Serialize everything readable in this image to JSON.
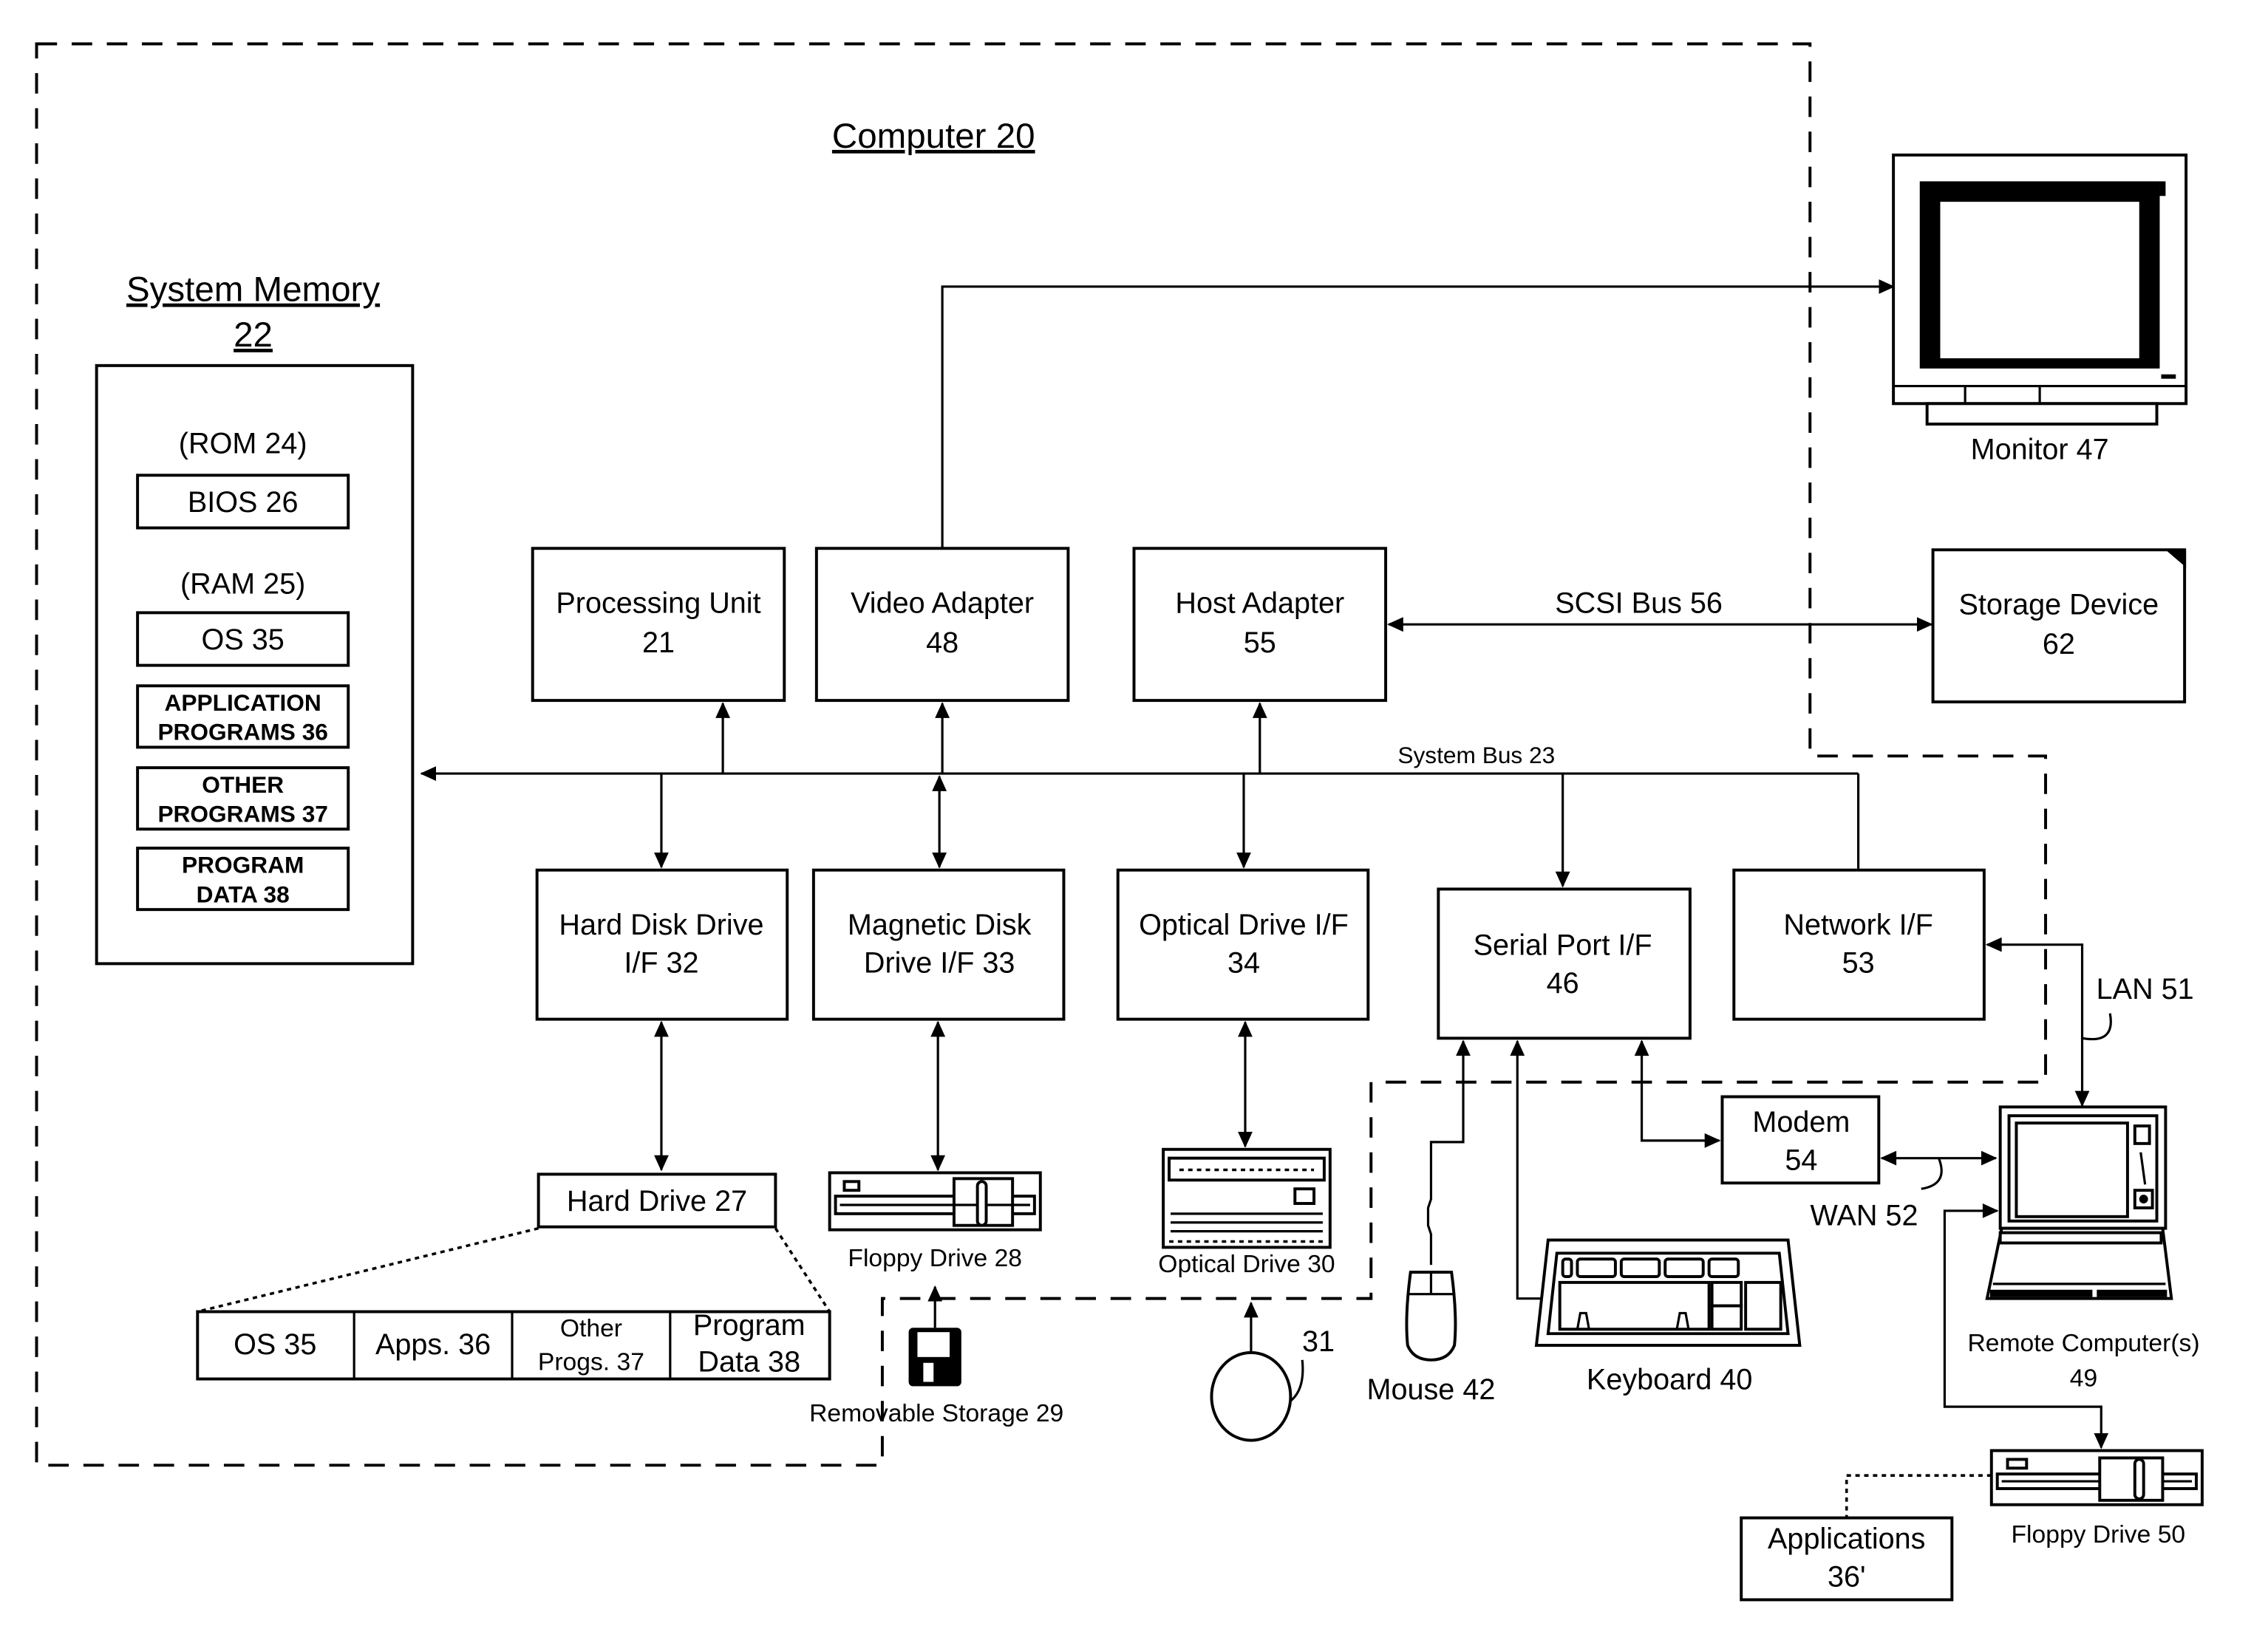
{
  "figure": {
    "computer_label": "Computer 20",
    "system_memory": {
      "title_line1": "System Memory",
      "title_line2": "22",
      "rom_label": "(ROM 24)",
      "bios_label": "BIOS 26",
      "ram_label": "(RAM 25)",
      "ram_items": [
        {
          "line1": "OS 35",
          "line2": ""
        },
        {
          "line1": "APPLICATION",
          "line2": "PROGRAMS 36"
        },
        {
          "line1": "OTHER",
          "line2": "PROGRAMS 37"
        },
        {
          "line1": "PROGRAM",
          "line2": "DATA 38"
        }
      ]
    },
    "upper_blocks": [
      {
        "line1": "Processing Unit",
        "line2": "21"
      },
      {
        "line1": "Video Adapter",
        "line2": "48"
      },
      {
        "line1": "Host Adapter",
        "line2": "55"
      }
    ],
    "system_bus_label": "System Bus 23",
    "scsi_bus_label": "SCSI Bus 56",
    "lower_blocks": [
      {
        "line1": "Hard Disk Drive",
        "line2": "I/F 32"
      },
      {
        "line1": "Magnetic Disk",
        "line2": "Drive I/F 33"
      },
      {
        "line1": "Optical Drive I/F",
        "line2": "34"
      },
      {
        "line1": "Serial Port I/F",
        "line2": "46"
      },
      {
        "line1": "Network I/F",
        "line2": "53"
      }
    ],
    "monitor_label": "Monitor 47",
    "storage_device": {
      "line1": "Storage Device",
      "line2": "62"
    },
    "hard_drive_label": "Hard Drive 27",
    "hard_drive_contents": [
      {
        "line1": "OS 35",
        "line2": ""
      },
      {
        "line1": "Apps. 36",
        "line2": ""
      },
      {
        "line1": "Other",
        "line2": "Progs. 37"
      },
      {
        "line1": "Program",
        "line2": "Data 38"
      }
    ],
    "floppy_drive_label": "Floppy Drive 28",
    "optical_drive_label": "Optical Drive 30",
    "removable_storage_label": "Removable Storage 29",
    "optical_disc_ref": "31",
    "mouse_label": "Mouse 42",
    "keyboard_label": "Keyboard 40",
    "modem": {
      "line1": "Modem",
      "line2": "54"
    },
    "lan_label": "LAN 51",
    "wan_label": "WAN 52",
    "remote_computer": {
      "line1": "Remote Computer(s)",
      "line2": "49"
    },
    "remote_floppy_label": "Floppy Drive 50",
    "remote_applications": {
      "line1": "Applications",
      "line2": "36'"
    }
  }
}
